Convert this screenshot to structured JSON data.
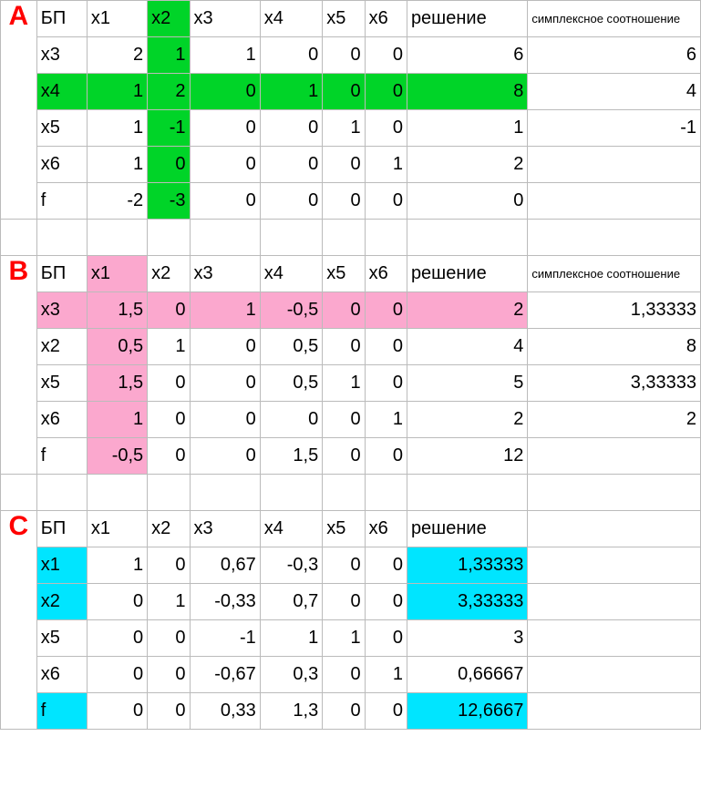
{
  "labels": {
    "A": "A",
    "B": "B",
    "C": "C"
  },
  "headers": {
    "bp": "БП",
    "x1": "x1",
    "x2": "x2",
    "x3": "x3",
    "x4": "x4",
    "x5": "x5",
    "x6": "x6",
    "solution": "решение",
    "ratio": "симплексное соотношение"
  },
  "A": {
    "rows": [
      {
        "bp": "x3",
        "x1": "2",
        "x2": "1",
        "x3": "1",
        "x4": "0",
        "x5": "0",
        "x6": "0",
        "sol": "6",
        "rat": "6"
      },
      {
        "bp": "x4",
        "x1": "1",
        "x2": "2",
        "x3": "0",
        "x4": "1",
        "x5": "0",
        "x6": "0",
        "sol": "8",
        "rat": "4"
      },
      {
        "bp": "x5",
        "x1": "1",
        "x2": "-1",
        "x3": "0",
        "x4": "0",
        "x5": "1",
        "x6": "0",
        "sol": "1",
        "rat": "-1"
      },
      {
        "bp": "x6",
        "x1": "1",
        "x2": "0",
        "x3": "0",
        "x4": "0",
        "x5": "0",
        "x6": "1",
        "sol": "2",
        "rat": ""
      },
      {
        "bp": "f",
        "x1": "-2",
        "x2": "-3",
        "x3": "0",
        "x4": "0",
        "x5": "0",
        "x6": "0",
        "sol": "0",
        "rat": ""
      }
    ]
  },
  "B": {
    "rows": [
      {
        "bp": "x3",
        "x1": "1,5",
        "x2": "0",
        "x3": "1",
        "x4": "-0,5",
        "x5": "0",
        "x6": "0",
        "sol": "2",
        "rat": "1,33333"
      },
      {
        "bp": "x2",
        "x1": "0,5",
        "x2": "1",
        "x3": "0",
        "x4": "0,5",
        "x5": "0",
        "x6": "0",
        "sol": "4",
        "rat": "8"
      },
      {
        "bp": "x5",
        "x1": "1,5",
        "x2": "0",
        "x3": "0",
        "x4": "0,5",
        "x5": "1",
        "x6": "0",
        "sol": "5",
        "rat": "3,33333"
      },
      {
        "bp": "x6",
        "x1": "1",
        "x2": "0",
        "x3": "0",
        "x4": "0",
        "x5": "0",
        "x6": "1",
        "sol": "2",
        "rat": "2"
      },
      {
        "bp": "f",
        "x1": "-0,5",
        "x2": "0",
        "x3": "0",
        "x4": "1,5",
        "x5": "0",
        "x6": "0",
        "sol": "12",
        "rat": ""
      }
    ]
  },
  "C": {
    "rows": [
      {
        "bp": "x1",
        "x1": "1",
        "x2": "0",
        "x3": "0,67",
        "x4": "-0,3",
        "x5": "0",
        "x6": "0",
        "sol": "1,33333"
      },
      {
        "bp": "x2",
        "x1": "0",
        "x2": "1",
        "x3": "-0,33",
        "x4": "0,7",
        "x5": "0",
        "x6": "0",
        "sol": "3,33333"
      },
      {
        "bp": "x5",
        "x1": "0",
        "x2": "0",
        "x3": "-1",
        "x4": "1",
        "x5": "1",
        "x6": "0",
        "sol": "3"
      },
      {
        "bp": "x6",
        "x1": "0",
        "x2": "0",
        "x3": "-0,67",
        "x4": "0,3",
        "x5": "0",
        "x6": "1",
        "sol": "0,66667"
      },
      {
        "bp": "f",
        "x1": "0",
        "x2": "0",
        "x3": "0,33",
        "x4": "1,3",
        "x5": "0",
        "x6": "0",
        "sol": "12,6667"
      }
    ]
  },
  "chart_data": [
    {
      "type": "table",
      "title": "Simplex tableau A (initial). Pivot column x2, pivot row x4.",
      "columns": [
        "БП",
        "x1",
        "x2",
        "x3",
        "x4",
        "x5",
        "x6",
        "решение",
        "симплексное соотношение"
      ],
      "rows": [
        [
          "x3",
          2,
          1,
          1,
          0,
          0,
          0,
          6,
          6
        ],
        [
          "x4",
          1,
          2,
          0,
          1,
          0,
          0,
          8,
          4
        ],
        [
          "x5",
          1,
          -1,
          0,
          0,
          1,
          0,
          1,
          -1
        ],
        [
          "x6",
          1,
          0,
          0,
          0,
          0,
          1,
          2,
          null
        ],
        [
          "f",
          -2,
          -3,
          0,
          0,
          0,
          0,
          0,
          null
        ]
      ],
      "pivot_column": "x2",
      "pivot_row_bp": "x4",
      "highlight_color": "#00d428"
    },
    {
      "type": "table",
      "title": "Simplex tableau B. Pivot column x1, pivot row x3.",
      "columns": [
        "БП",
        "x1",
        "x2",
        "x3",
        "x4",
        "x5",
        "x6",
        "решение",
        "симплексное соотношение"
      ],
      "rows": [
        [
          "x3",
          1.5,
          0,
          1,
          -0.5,
          0,
          0,
          2,
          1.33333
        ],
        [
          "x2",
          0.5,
          1,
          0,
          0.5,
          0,
          0,
          4,
          8
        ],
        [
          "x5",
          1.5,
          0,
          0,
          0.5,
          1,
          0,
          5,
          3.33333
        ],
        [
          "x6",
          1,
          0,
          0,
          0,
          0,
          1,
          2,
          2
        ],
        [
          "f",
          -0.5,
          0,
          0,
          1.5,
          0,
          0,
          12,
          null
        ]
      ],
      "pivot_column": "x1",
      "pivot_row_bp": "x3",
      "highlight_color": "#fba8ce"
    },
    {
      "type": "table",
      "title": "Simplex tableau C (final/optimal).",
      "columns": [
        "БП",
        "x1",
        "x2",
        "x3",
        "x4",
        "x5",
        "x6",
        "решение"
      ],
      "rows": [
        [
          "x1",
          1,
          0,
          0.67,
          -0.3,
          0,
          0,
          1.33333
        ],
        [
          "x2",
          0,
          1,
          -0.33,
          0.7,
          0,
          0,
          3.33333
        ],
        [
          "x5",
          0,
          0,
          -1,
          1,
          1,
          0,
          3
        ],
        [
          "x6",
          0,
          0,
          -0.67,
          0.3,
          0,
          1,
          0.66667
        ],
        [
          "f",
          0,
          0,
          0.33,
          1.3,
          0,
          0,
          12.6667
        ]
      ],
      "highlight_cells": "bp column and solution column of rows x1,x2,f",
      "highlight_color": "#00e5ff",
      "objective_value": 12.6667
    }
  ]
}
